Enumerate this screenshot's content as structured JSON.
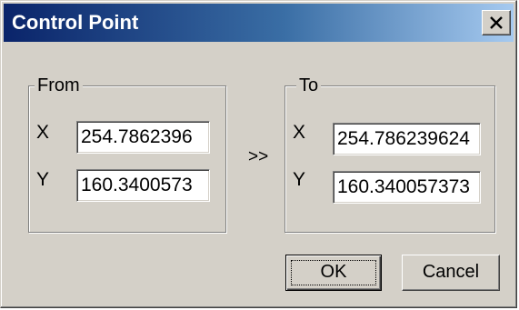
{
  "window": {
    "title": "Control Point",
    "close_icon": "close-x-icon"
  },
  "from_group": {
    "legend": "From",
    "x_label": "X",
    "y_label": "Y",
    "x_value": "254.7862396",
    "y_value": "160.3400573"
  },
  "to_group": {
    "legend": "To",
    "x_label": "X",
    "y_label": "Y",
    "x_value": "254.786239624",
    "y_value": "160.340057373"
  },
  "arrow": ">>",
  "buttons": {
    "ok": "OK",
    "cancel": "Cancel"
  },
  "colors": {
    "face": "#d4d0c8",
    "title_start": "#0a246a",
    "title_end": "#a6caf0"
  }
}
